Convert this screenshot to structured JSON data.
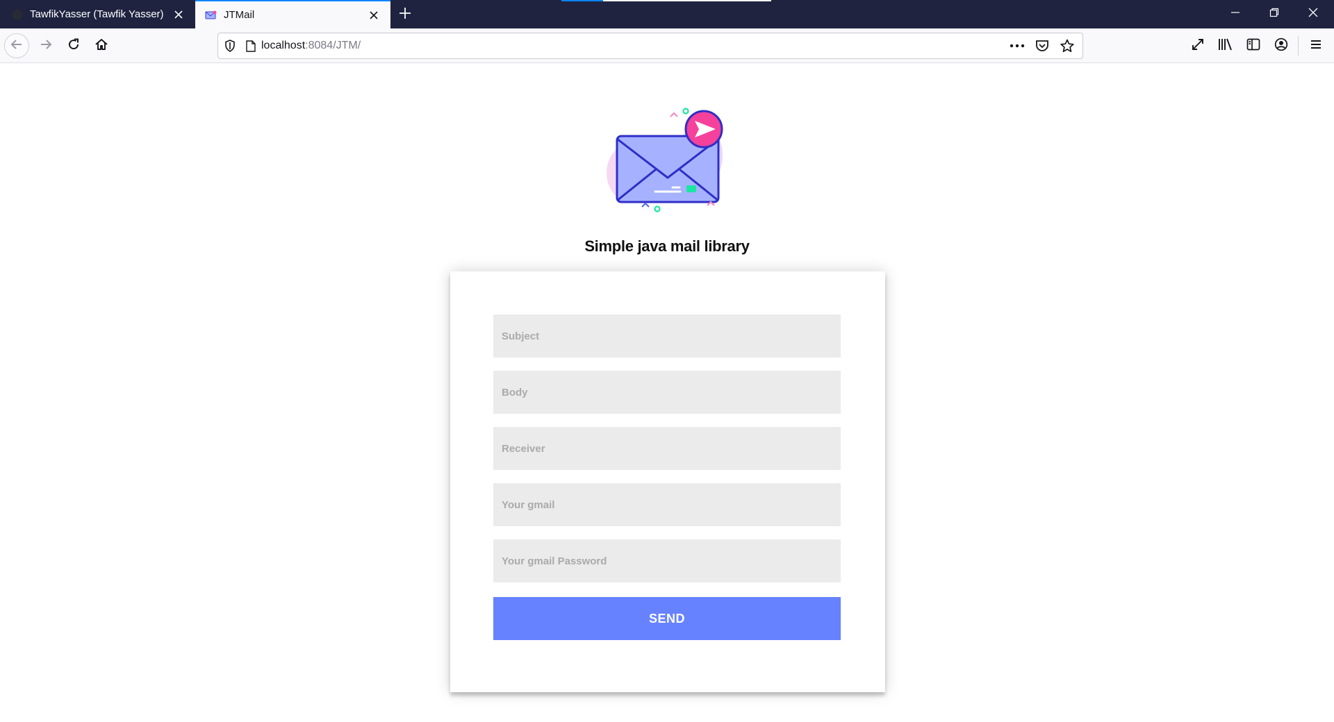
{
  "browser": {
    "tabs": [
      {
        "label": "TawfikYasser (Tawfik Yasser)",
        "active": false
      },
      {
        "label": "JTMail",
        "active": true
      }
    ],
    "url_host": "localhost",
    "url_rest": ":8084/JTM/"
  },
  "page": {
    "heading": "Simple java mail library",
    "form": {
      "subject_placeholder": "Subject",
      "body_placeholder": "Body",
      "receiver_placeholder": "Receiver",
      "gmail_placeholder": "Your gmail",
      "password_placeholder": "Your gmail Password",
      "send_label": "SEND"
    }
  },
  "icons": {
    "back": "arrow-left-icon",
    "forward": "arrow-right-icon",
    "reload": "reload-icon",
    "home": "home-icon",
    "shield": "shield-icon",
    "page": "page-icon",
    "more": "ellipsis-icon",
    "pocket": "pocket-icon",
    "bookmark": "star-icon",
    "fullscreen": "expand-icon",
    "library": "library-icon",
    "sidebar": "sidebar-icon",
    "account": "account-icon",
    "menu": "hamburger-icon"
  },
  "colors": {
    "titlebar": "#1f2340",
    "accent": "#6682ff",
    "field_bg": "#ebebeb",
    "tab_highlight": "#0a84ff"
  }
}
